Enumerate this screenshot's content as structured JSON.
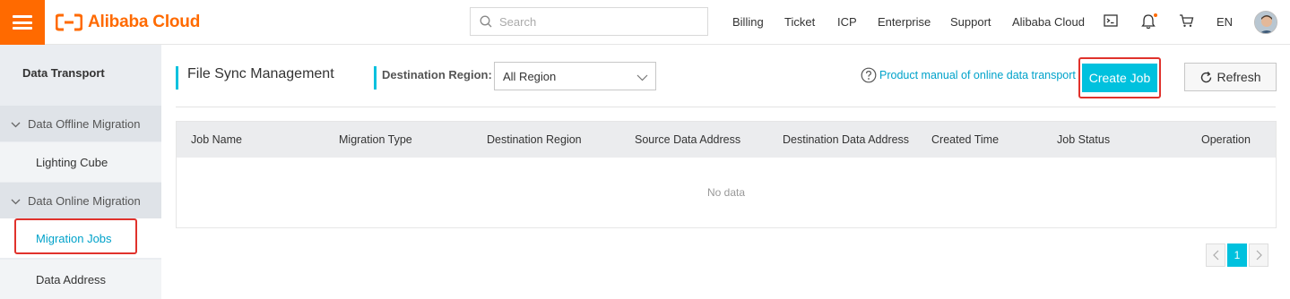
{
  "header": {
    "brand": "Alibaba Cloud",
    "search": {
      "placeholder": "Search"
    },
    "nav": [
      "Billing",
      "Ticket",
      "ICP",
      "Enterprise",
      "Support",
      "Alibaba Cloud"
    ],
    "language": "EN",
    "icons": [
      "menu-icon",
      "terminal-icon",
      "bell-icon",
      "cart-icon"
    ],
    "brand_color": "#ff6a00"
  },
  "sidebar": {
    "title": "Data Transport",
    "groups": [
      {
        "label": "Data Offline Migration",
        "items": [
          "Lighting Cube"
        ]
      },
      {
        "label": "Data Online Migration",
        "items": [
          "Migration Jobs",
          "Data Address"
        ]
      }
    ],
    "active_item": "Migration Jobs"
  },
  "main": {
    "title": "File Sync Management",
    "region_label": "Destination Region:",
    "region_value": "All Region",
    "manual_link": "Product manual of online data transport",
    "create_button": "Create Job",
    "refresh_button": "Refresh",
    "accent_color": "#00c1de",
    "table": {
      "columns": [
        "Job Name",
        "Migration Type",
        "Destination Region",
        "Source Data Address",
        "Destination Data Address",
        "Created Time",
        "Job Status",
        "Operation"
      ],
      "rows": [],
      "empty_text": "No data"
    },
    "pagination": {
      "current_page": "1"
    }
  }
}
